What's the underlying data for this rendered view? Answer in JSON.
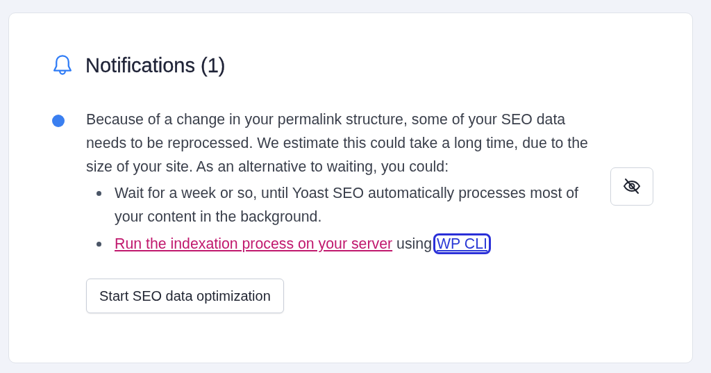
{
  "panel": {
    "title": "Notifications (1)"
  },
  "notification": {
    "unread": true,
    "message": "Because of a change in your permalink structure, some of your SEO data needs to be reprocessed. We estimate this could take a long time, due to the size of your site. As an alternative to waiting, you could:",
    "options": [
      {
        "kind": "text",
        "text": "Wait for a week or so, until Yoast SEO automatically processes most of your content in the background."
      },
      {
        "kind": "links",
        "link": "Run the indexation process on your server",
        "text": " using",
        "link_2": "WP CLI",
        "link_2_focused": true
      }
    ],
    "button": "Start SEO data optimization",
    "hidden": false
  }
}
